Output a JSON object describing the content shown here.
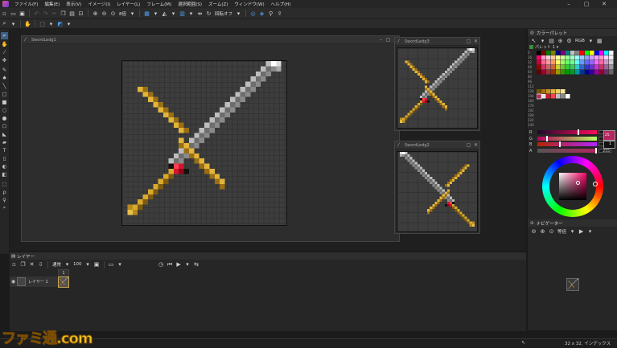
{
  "menu": {
    "items": [
      "ファイル(F)",
      "編集(E)",
      "表示(V)",
      "イメージ(I)",
      "レイヤー(L)",
      "フレーム(M)",
      "選択範囲(S)",
      "ズーム(Z)",
      "ウィンドウ(W)",
      "ヘルプ(H)"
    ],
    "window_controls": [
      "–",
      "▢",
      "✕"
    ]
  },
  "toolbar": {
    "zoom_value": "8倍",
    "rotation_label": "回転オフ"
  },
  "documents": [
    {
      "title": "SwordLedg1"
    },
    {
      "title": "SwordLedg3"
    },
    {
      "title": "SwordLedg2"
    }
  ],
  "color_palette": {
    "title": "カラーパレット",
    "mode": "RGB",
    "palette_name": "パレット 1",
    "row_labels": [
      "0",
      "16",
      "32",
      "48",
      "64",
      "80",
      "96",
      "112",
      "128",
      "144",
      "160",
      "176",
      "192",
      "208",
      "224",
      "240"
    ],
    "channels": [
      {
        "label": "R",
        "value": "179",
        "fraction": 0.7,
        "gradient": "linear-gradient(90deg,#1e0b2c,#ff0b5c)"
      },
      {
        "label": "G",
        "value": "38",
        "fraction": 0.15,
        "gradient": "linear-gradient(90deg,#b3005e,#b3ff5e)"
      },
      {
        "label": "B",
        "value": "94",
        "fraction": 0.37,
        "gradient": "linear-gradient(90deg,#b32600,#b326ff)"
      },
      {
        "label": "A",
        "value": "255",
        "fraction": 1.0,
        "gradient": "linear-gradient(90deg,#555,#b3265e)"
      }
    ],
    "current_color": "#b3265e",
    "swatch_small_value": "25",
    "swatch_small_value2": "1"
  },
  "navigator": {
    "title": "ナビゲーター",
    "zoom": "等倍"
  },
  "layers": {
    "title": "レイヤー",
    "blend_mode": "通常",
    "opacity": "100",
    "frame_number": "1",
    "items": [
      {
        "name": "レイヤー 1"
      }
    ]
  },
  "status": {
    "size_text": "32 x 32, インデックス"
  },
  "watermark": "ファミ通.com",
  "colors": {
    "accent": "#3b7fd0",
    "background": "#1b1b1b"
  }
}
